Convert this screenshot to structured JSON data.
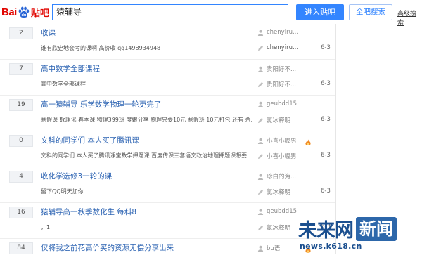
{
  "logo": {
    "bai": "Bai",
    "du": "du",
    "tieba": "贴吧"
  },
  "search": {
    "value": "猿辅导"
  },
  "buttons": {
    "enter": "进入贴吧",
    "search_all": "全吧搜索",
    "advanced": "高级搜索"
  },
  "threads": [
    {
      "replies": "2",
      "title": "收课",
      "abstract": "谁有欣史地会考的课啊 高价收 qq1498934948",
      "author": "chenyiru...",
      "last_replier": "chenyiru...",
      "last_dark": true,
      "date": "6-3",
      "badge": false
    },
    {
      "replies": "7",
      "title": "高中数学全部课程",
      "abstract": "高中数学全部课程",
      "author": "贵阳好不...",
      "last_replier": "贵阳好不...",
      "last_dark": false,
      "date": "6-3",
      "badge": false
    },
    {
      "replies": "19",
      "title": "高一猿辅导 乐学数学物理一轮更完了",
      "abstract": "寒假课 数理化 春季课 物理399班 度娘分享 物理只要10元 寒假班 10元打包 还有 杀…",
      "author": "geubdd15",
      "last_replier": "氯冰释明",
      "last_dark": false,
      "date": "6-3",
      "badge": false
    },
    {
      "replies": "0",
      "title": "文科的同学们 本人买了腾讯课",
      "abstract": "文科的同学们 本人买了腾讯课堂数学押题课 百度传课三套语文政治地理押题课想要…",
      "author": "小喜小喔男",
      "last_replier": "小喜小喔男",
      "last_dark": false,
      "date": "6-3",
      "badge": true
    },
    {
      "replies": "4",
      "title": "收化学选修3一轮的课",
      "abstract": "留下QQ明天加你",
      "author": "珍白的海...",
      "last_replier": "氯冰释明",
      "last_dark": false,
      "date": "6-3",
      "badge": false
    },
    {
      "replies": "16",
      "title": "猿辅导高一秋季数化生 每科8",
      "abstract": "，1",
      "author": "geubdd15",
      "last_replier": "氯冰释明",
      "last_dark": false,
      "date": "6-3",
      "badge": false
    },
    {
      "replies": "84",
      "title": "仅将我之前花高价买的资源无偿分享出来",
      "abstract": "",
      "author": "bu语",
      "last_replier": "",
      "last_dark": false,
      "date": "",
      "badge": true
    }
  ],
  "watermark": {
    "text": "未来网",
    "box": "新闻",
    "url": "news.k618.cn"
  },
  "colors": {
    "brand_red": "#e10601",
    "link_blue": "#2d64b3",
    "button_blue": "#3385ff",
    "watermark_blue": "#1b4f8f"
  },
  "icons": {
    "person": "user-icon",
    "badge": "fire-badge-icon",
    "logo_paw": "baidu-paw-icon"
  }
}
